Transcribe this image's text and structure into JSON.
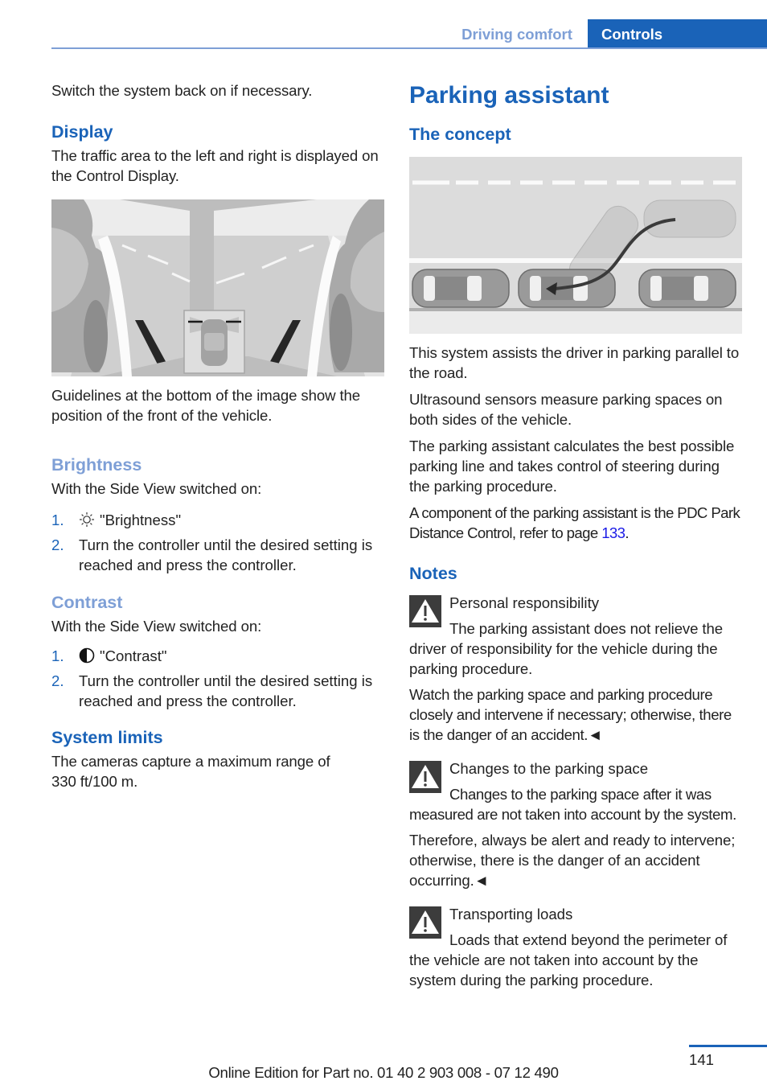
{
  "header": {
    "section": "Driving comfort",
    "chapter": "Controls"
  },
  "left": {
    "intro": "Switch the system back on if necessary.",
    "display": {
      "heading": "Display",
      "text": "The traffic area to the left and right is displayed on the Control Display.",
      "figure_caption": "Guidelines at the bottom of the image show the position of the front of the vehicle."
    },
    "brightness": {
      "heading": "Brightness",
      "intro": "With the Side View switched on:",
      "steps": [
        {
          "num": "1.",
          "icon": "brightness-sun-icon",
          "text": "\"Brightness\""
        },
        {
          "num": "2.",
          "text": "Turn the controller until the desired setting is reached and press the controller."
        }
      ]
    },
    "contrast": {
      "heading": "Contrast",
      "intro": "With the Side View switched on:",
      "steps": [
        {
          "num": "1.",
          "icon": "contrast-half-circle-icon",
          "text": "\"Contrast\""
        },
        {
          "num": "2.",
          "text": "Turn the controller until the desired setting is reached and press the controller."
        }
      ]
    },
    "system_limits": {
      "heading": "System limits",
      "text": "The cameras capture a maximum range of 330 ft/100 m."
    }
  },
  "right": {
    "title": "Parking assistant",
    "concept": {
      "heading": "The concept",
      "paragraphs": [
        "This system assists the driver in parking parallel to the road.",
        "Ultrasound sensors measure parking spaces on both sides of the vehicle.",
        "The parking assistant calculates the best pos­sible parking line and takes control of steering during the parking procedure."
      ],
      "pdc_text": "A component of the parking assistant is the PDC Park Distance Control, refer to page ",
      "pdc_page_link": "133",
      "pdc_end": "."
    },
    "notes": {
      "heading": "Notes",
      "items": [
        {
          "icon": "warning-triangle-icon",
          "title": "Personal responsibility",
          "paragraphs": [
            "The parking assistant does not relieve the driver of responsibility for the vehicle during the parking procedure.",
            "Watch the parking space and parking procedure closely and intervene if necessary; otherwise, there is the danger of an accident.◄"
          ]
        },
        {
          "icon": "warning-triangle-icon",
          "title": "Changes to the parking space",
          "paragraphs": [
            "Changes to the parking space after it was measured are not taken into account by the sys­tem.",
            "Therefore, always be alert and ready to inter­vene; otherwise, there is the danger of an acci­dent occurring.◄"
          ]
        },
        {
          "icon": "warning-triangle-icon",
          "title": "Transporting loads",
          "paragraphs": [
            "Loads that extend beyond the perimeter of the vehicle are not taken into account by the system during the parking procedure."
          ]
        }
      ]
    }
  },
  "footer": {
    "page_number": "141",
    "edition": "Online Edition for Part no. 01 40 2 903 008 - 07 12 490"
  }
}
